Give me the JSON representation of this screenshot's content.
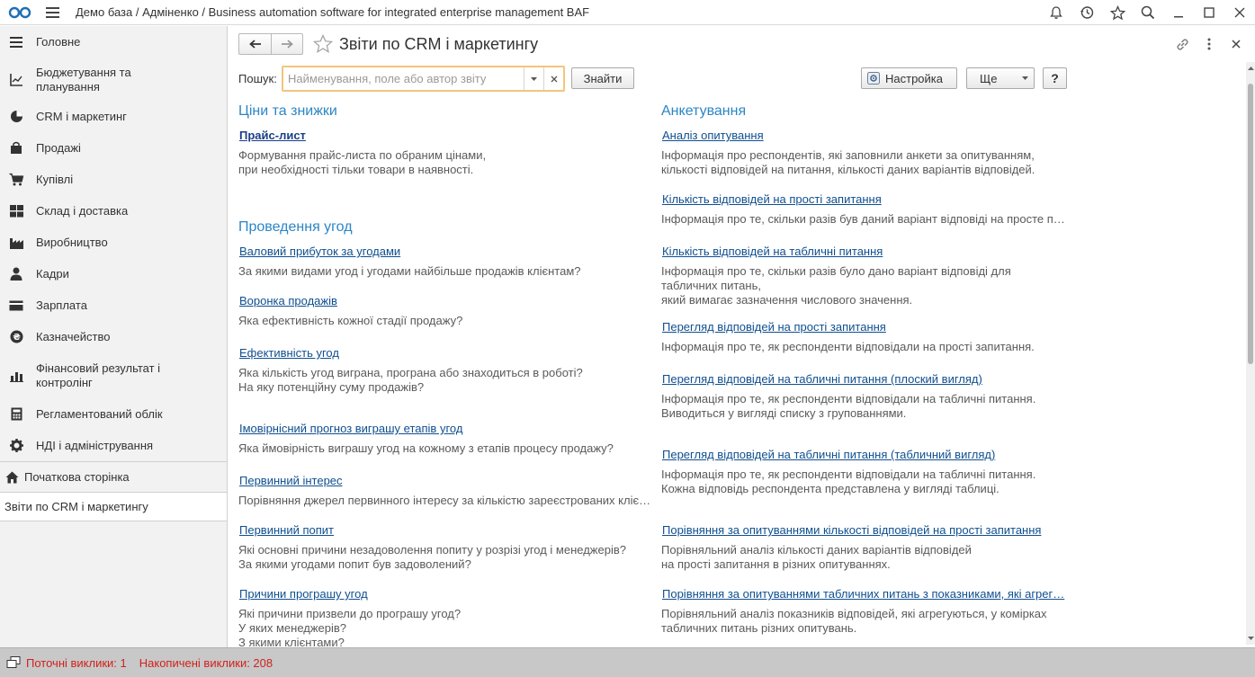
{
  "titlebar": {
    "logo_icon": "1c-logo-icon",
    "title": "Демо база / Адміненко / Business automation software for integrated enterprise management BAF",
    "tools": [
      "bell-icon",
      "history-icon",
      "star-icon",
      "search-icon",
      "minimize-icon",
      "maximize-icon",
      "close-icon"
    ]
  },
  "sidebar": {
    "items": [
      {
        "label": "Головне",
        "icon": "menu-lines-icon"
      },
      {
        "label": "Бюджетування та\nпланування",
        "icon": "chart-axes-icon"
      },
      {
        "label": "CRM і маркетинг",
        "icon": "pie-chart-icon"
      },
      {
        "label": "Продажі",
        "icon": "shopping-bag-icon"
      },
      {
        "label": "Купівлі",
        "icon": "cart-icon"
      },
      {
        "label": "Склад і доставка",
        "icon": "warehouse-grid-icon"
      },
      {
        "label": "Виробництво",
        "icon": "factory-icon"
      },
      {
        "label": "Кадри",
        "icon": "person-icon"
      },
      {
        "label": "Зарплата",
        "icon": "card-icon"
      },
      {
        "label": "Казначейство",
        "icon": "coin-icon"
      },
      {
        "label": "Фінансовий результат і\nконтролінг",
        "icon": "bar-chart-icon"
      },
      {
        "label": "Регламентований облік",
        "icon": "calculator-icon"
      },
      {
        "label": "НДІ і адміністрування",
        "icon": "gear-icon"
      }
    ],
    "home_label": "Початкова сторінка",
    "open_tab_label": "Звіти по CRM і маркетингу"
  },
  "page": {
    "title": "Звіти по CRM і маркетингу",
    "search_label": "Пошук:",
    "search_placeholder": "Найменування, поле або автор звіту",
    "search_value": "",
    "find_button": "Знайти",
    "settings_button": "Настройка",
    "more_button": "Ще",
    "help_button": "?"
  },
  "left_column": {
    "sections": [
      {
        "title": "Ціни та знижки",
        "reports": [
          {
            "name": "Прайс-лист",
            "bold": true,
            "desc": "Формування прайс-листа по обраним цінами,\nпри необхідності тільки товари в наявності."
          }
        ]
      },
      {
        "title": "Проведення угод",
        "reports": [
          {
            "name": "Валовий прибуток за угодами",
            "desc": "За якими видами угод і угодами найбільше продажів клієнтам?"
          },
          {
            "name": "Воронка продажів",
            "desc": "Яка ефективність кожної стадії продажу?"
          },
          {
            "name": "Ефективність угод",
            "desc": "Яка кількість угод виграна, програна або знаходиться в роботі?\nНа яку потенційну суму продажів?"
          },
          {
            "name": "Імовірнісний прогноз виграшу етапів угод",
            "desc": "Яка ймовірність виграшу угод на кожному з етапів процесу продажу?"
          },
          {
            "name": "Первинний інтерес",
            "desc": "Порівняння джерел первинного інтересу за кількістю зареєстрованих кліє…"
          },
          {
            "name": "Первинний попит",
            "desc": "Які основні причини незадоволення попиту у розрізі угод і менеджерів?\nЗа якими угодами попит був задоволений?"
          },
          {
            "name": "Причини програшу угод",
            "desc": "Які причини призвели до програшу угод?\nУ яких менеджерів?\nЗ якими клієнтами?"
          }
        ]
      }
    ]
  },
  "right_column": {
    "sections": [
      {
        "title": "Анкетування",
        "reports": [
          {
            "name": "Аналіз опитування",
            "desc": "Інформація про респондентів, які заповнили анкети за опитуванням,\nкількості відповідей на питання, кількості даних варіантів відповідей."
          },
          {
            "name": "Кількість відповідей на прості запитання",
            "desc": "Інформація про те, скільки разів був даний варіант відповіді на просте п…"
          },
          {
            "name": "Кількість відповідей на табличні питання",
            "desc": "Інформація про те, скільки разів було дано варіант відповіді для\nтабличних питань,\nякий вимагає зазначення числового значення."
          },
          {
            "name": "Перегляд відповідей на прості запитання",
            "desc": "Інформація про те, як респонденти відповідали на прості запитання."
          },
          {
            "name": "Перегляд відповідей на табличні питання (плоский вигляд)",
            "desc": "Інформація про те, як респонденти відповідали на табличні питання.\nВиводиться у вигляді списку з групованнями."
          },
          {
            "name": "Перегляд відповідей на табличні питання (табличний вигляд)",
            "desc": "Інформація про те, як респонденти відповідали на табличні питання.\nКожна відповідь респондента представлена у вигляді таблиці."
          },
          {
            "name": "Порівняння за опитуваннями кількості відповідей на прості запитання",
            "desc": "Порівняльний аналіз кількості даних варіантів відповідей\nна прості запитання в різних опитуваннях."
          },
          {
            "name": "Порівняння за опитуваннями табличних питань з показниками, які агрег…",
            "desc": "Порівняльний аналіз показників відповідей, які агрегуються, у комірках\nтабличних питань різних опитувань."
          }
        ]
      }
    ]
  },
  "statusbar": {
    "current_calls": "Поточні виклики: 1",
    "accumulated_calls": "Накопичені виклики: 208",
    "color": "#d0211b"
  }
}
